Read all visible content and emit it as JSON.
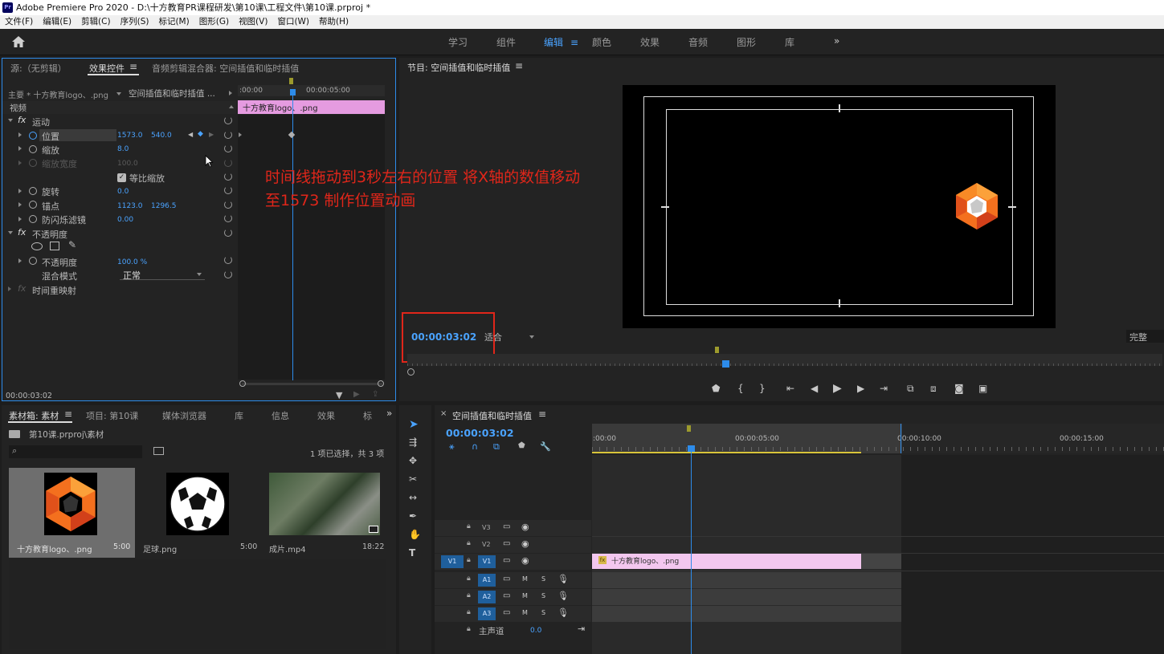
{
  "app": {
    "title": "Adobe Premiere Pro 2020 - D:\\十方教育PR课程研发\\第10课\\工程文件\\第10课.prproj *",
    "logo_text": "Pr"
  },
  "menu": [
    "文件(F)",
    "编辑(E)",
    "剪辑(C)",
    "序列(S)",
    "标记(M)",
    "图形(G)",
    "视图(V)",
    "窗口(W)",
    "帮助(H)"
  ],
  "workspaces": {
    "tabs": [
      "学习",
      "组件",
      "编辑",
      "颜色",
      "效果",
      "音频",
      "图形",
      "库"
    ],
    "active": "编辑",
    "more": "»"
  },
  "effect_controls": {
    "tabs": [
      "源:（无剪辑）",
      "效果控件",
      "音频剪辑混合器: 空间插值和临时插值"
    ],
    "active_tab": "效果控件",
    "master_label": "主要 * 十方教育logo、.png",
    "sequence_label": "空间插值和临时插值 ...",
    "section_video": "视频",
    "ruler_start": ":00:00",
    "ruler_mid": "00:00:05:00",
    "clip_name": "十方教育logo、.png",
    "motion": "运动",
    "properties": [
      {
        "name": "位置",
        "v1": "1573.0",
        "v2": "540.0"
      },
      {
        "name": "缩放",
        "v1": "8.0"
      },
      {
        "name": "缩放宽度",
        "v1": "100.0"
      },
      {
        "name": "等比缩放"
      },
      {
        "name": "旋转",
        "v1": "0.0"
      },
      {
        "name": "锚点",
        "v1": "1123.0",
        "v2": "1296.5"
      },
      {
        "name": "防闪烁滤镜",
        "v1": "0.00"
      }
    ],
    "opacity_section": "不透明度",
    "opacity_name": "不透明度",
    "opacity_value": "100.0 %",
    "blend_label": "混合模式",
    "blend_value": "正常",
    "time_remap": "时间重映射",
    "timecode": "00:00:03:02"
  },
  "program_monitor": {
    "title": "节目: 空间插值和临时插值",
    "timecode": "00:00:03:02",
    "fit": "适合",
    "quality": "完整"
  },
  "annotation": {
    "line1": "时间线拖动到3秒左右的位置 将X轴的数值移动",
    "line2": "至1573 制作位置动画",
    "color": "#e0261a"
  },
  "project": {
    "tabs": [
      "素材箱: 素材",
      "项目: 第10课",
      "媒体浏览器",
      "库",
      "信息",
      "效果",
      "标"
    ],
    "active_tab": "素材箱: 素材",
    "path": "第10课.prproj\\素材",
    "selection": "1 项已选择，共 3 项",
    "items": [
      {
        "name": "十方教育logo、.png",
        "duration": "5:00"
      },
      {
        "name": "足球.png",
        "duration": "5:00"
      },
      {
        "name": "成片.mp4",
        "duration": "18:22"
      }
    ]
  },
  "timeline": {
    "title": "空间插值和临时插值",
    "timecode": "00:00:03:02",
    "ruler": [
      ":00:00",
      "00:00:05:00",
      "00:00:10:00",
      "00:00:15:00"
    ],
    "video_tracks": [
      "V3",
      "V2",
      "V1"
    ],
    "audio_tracks": [
      "A1",
      "A2",
      "A3"
    ],
    "source_v": "V1",
    "master": "主声道",
    "master_value": "0.0",
    "clip": "十方教育logo、.png",
    "fx_badge": "fx",
    "mute": "M",
    "solo": "S"
  },
  "colors": {
    "accent": "#2d8ceb",
    "clip_pink": "#e59be0",
    "clip_light": "#f3c7ef",
    "annotation_red": "#e0261a"
  }
}
